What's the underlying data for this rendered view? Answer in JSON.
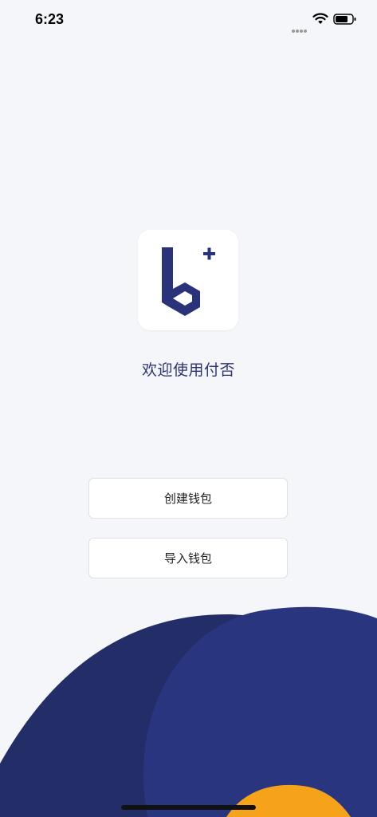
{
  "status_bar": {
    "time": "6:23",
    "icons": [
      "signal-dots-icon",
      "wifi-icon",
      "battery-icon"
    ]
  },
  "app": {
    "logo_icon": "b-plus-logo-icon",
    "welcome_text": "欢迎使用付否"
  },
  "actions": {
    "create_wallet_label": "创建钱包",
    "import_wallet_label": "导入钱包"
  },
  "colors": {
    "background": "#f5f6fa",
    "brand_navy": "#2a3279",
    "wave_dark": "#232d68",
    "wave_mid": "#29357e",
    "wave_accent": "#f7a21b",
    "welcome_text": "#2e3472"
  }
}
